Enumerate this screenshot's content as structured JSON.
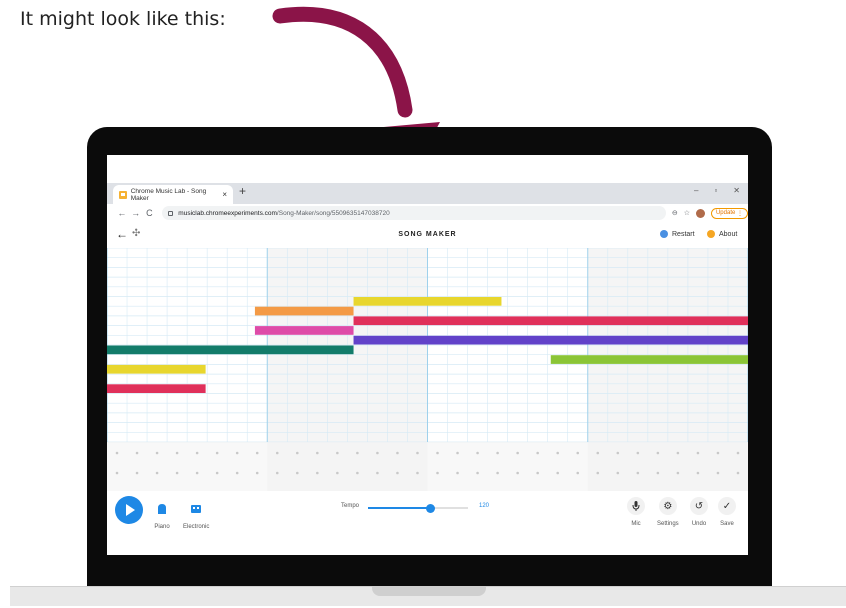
{
  "caption": "It might look like this:",
  "colors": {
    "arrow": "#8b1448",
    "accent_blue": "#1e88e5",
    "restart_dot": "#4a90e2",
    "about_dot": "#f5a623",
    "note_yellow": "#e8d62d",
    "note_orange": "#f49a45",
    "note_crimson": "#e0305a",
    "note_pink": "#de4ba8",
    "note_purple": "#6242c9",
    "note_teal": "#137c6a",
    "note_green": "#8bc536"
  },
  "browser": {
    "tab_title": "Chrome Music Lab - Song Maker",
    "tab_close": "×",
    "new_tab": "+",
    "window_controls": [
      "–",
      "▫",
      "✕"
    ],
    "nav": [
      "←",
      "→",
      "C"
    ],
    "url_host": "musiclab.chromeexperiments.com",
    "url_path": "/Song-Maker/song/5509635147038720",
    "update_label": "Update"
  },
  "app": {
    "back_icon": "←",
    "move_icon": "✣",
    "title": "SONG MAKER",
    "restart_label": "Restart",
    "about_label": "About"
  },
  "controls": {
    "piano_label": "Piano",
    "electronic_label": "Electronic",
    "tempo_label": "Tempo",
    "tempo_value": "120",
    "tempo_fraction": 0.62,
    "mic_label": "Mic",
    "settings_label": "Settings",
    "undo_label": "Undo",
    "save_label": "Save"
  },
  "song": {
    "bars": 4,
    "beats_per_bar": 4,
    "subdivisions": 8,
    "pitch_rows": 20,
    "notes": [
      {
        "color": "note_yellow",
        "row": 5,
        "start": 20,
        "length": 12
      },
      {
        "color": "note_orange",
        "row": 6,
        "start": 12,
        "length": 8
      },
      {
        "color": "note_crimson",
        "row": 7,
        "start": 20,
        "length": 32
      },
      {
        "color": "note_pink",
        "row": 8,
        "start": 12,
        "length": 8
      },
      {
        "color": "note_purple",
        "row": 9,
        "start": 20,
        "length": 32
      },
      {
        "color": "note_teal",
        "row": 10,
        "start": 0,
        "length": 20
      },
      {
        "color": "note_green",
        "row": 11,
        "start": 36,
        "length": 16
      },
      {
        "color": "note_yellow",
        "row": 12,
        "start": 0,
        "length": 8
      },
      {
        "color": "note_crimson",
        "row": 14,
        "start": 0,
        "length": 8
      }
    ]
  }
}
